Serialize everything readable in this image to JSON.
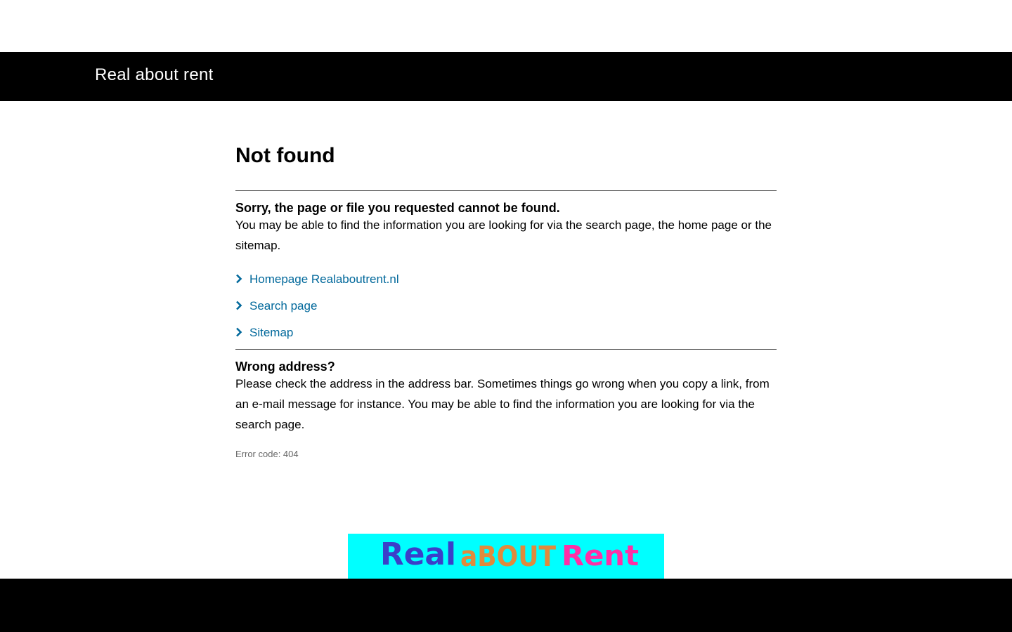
{
  "header": {
    "site_title": "Real about rent"
  },
  "main": {
    "heading": "Not found",
    "subheading": "Sorry, the page or file you requested cannot be found.",
    "intro": "You may be able to find the information you are looking for via the search page, the home page or the sitemap.",
    "links": [
      {
        "label": "Homepage Realaboutrent.nl",
        "icon": "chevron-right-icon"
      },
      {
        "label": "Search page",
        "icon": "chevron-right-icon"
      },
      {
        "label": "Sitemap",
        "icon": "chevron-right-icon"
      }
    ],
    "wrong_address_heading": "Wrong address?",
    "wrong_address_text": "Please check the address in the address bar. Sometimes things go wrong when you copy a link, from an e-mail message for instance. You may be able to find the information you are looking for via the search page.",
    "error_code": "Error code: 404"
  },
  "banner": {
    "logo_text": "Real about Rent",
    "background": "#00ffff",
    "colors": {
      "real": "#3b3fc9",
      "about": "#e08a3c",
      "rent": "#ff2ea6"
    }
  },
  "colors": {
    "link": "#01689b",
    "header_bg": "#000000",
    "footer_bg": "#000000"
  }
}
